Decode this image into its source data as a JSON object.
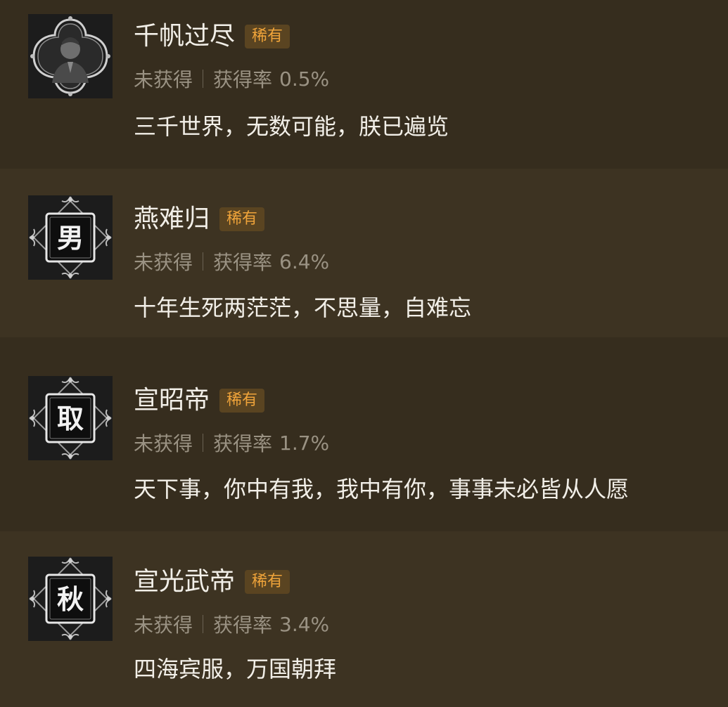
{
  "achievements": [
    {
      "name": "千帆过尽",
      "rarity": "稀有",
      "status": "未获得",
      "rate_label": "获得率",
      "rate_value": "0.5%",
      "description": "三千世界，无数可能，朕已遍览",
      "icon": "portrait-icon",
      "icon_char": ""
    },
    {
      "name": "燕难归",
      "rarity": "稀有",
      "status": "未获得",
      "rate_label": "获得率",
      "rate_value": "6.4%",
      "description": "十年生死两茫茫，不思量，自难忘",
      "icon": "seal-icon",
      "icon_char": "男"
    },
    {
      "name": "宣昭帝",
      "rarity": "稀有",
      "status": "未获得",
      "rate_label": "获得率",
      "rate_value": "1.7%",
      "description": "天下事，你中有我，我中有你，事事未必皆从人愿",
      "icon": "seal-icon",
      "icon_char": "取"
    },
    {
      "name": "宣光武帝",
      "rarity": "稀有",
      "status": "未获得",
      "rate_label": "获得率",
      "rate_value": "3.4%",
      "description": "四海宾服，万国朝拜",
      "icon": "seal-icon",
      "icon_char": "秋"
    }
  ],
  "colors": {
    "background_odd": "#362d1e",
    "background_even": "#3d3322",
    "rarity_bg": "#5a4421",
    "rarity_text": "#f0a43a",
    "title_text": "#f2efe8",
    "meta_text": "#9a9283"
  }
}
